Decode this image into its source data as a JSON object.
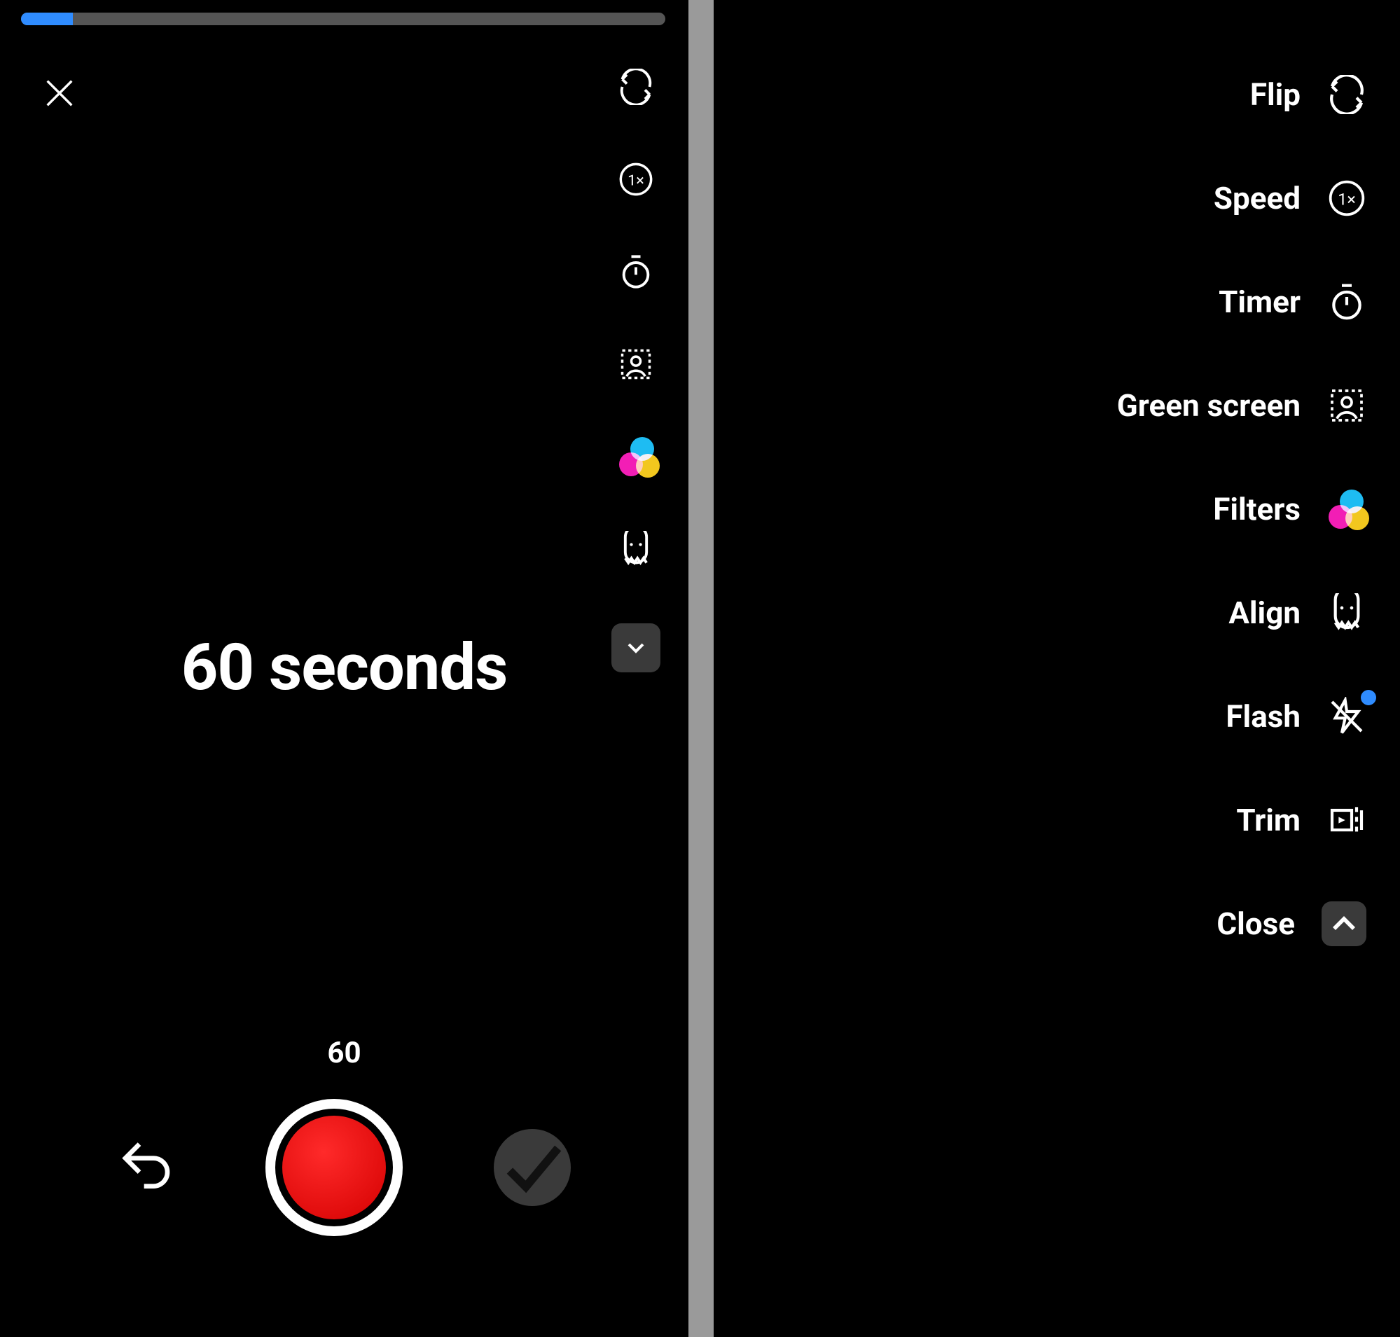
{
  "progress": {
    "percent": 8
  },
  "center_text": "60 seconds",
  "duration_label": "60",
  "menu": {
    "flip": "Flip",
    "speed": "Speed",
    "timer": "Timer",
    "green_screen": "Green screen",
    "filters": "Filters",
    "align": "Align",
    "flash": "Flash",
    "trim": "Trim",
    "close": "Close"
  }
}
